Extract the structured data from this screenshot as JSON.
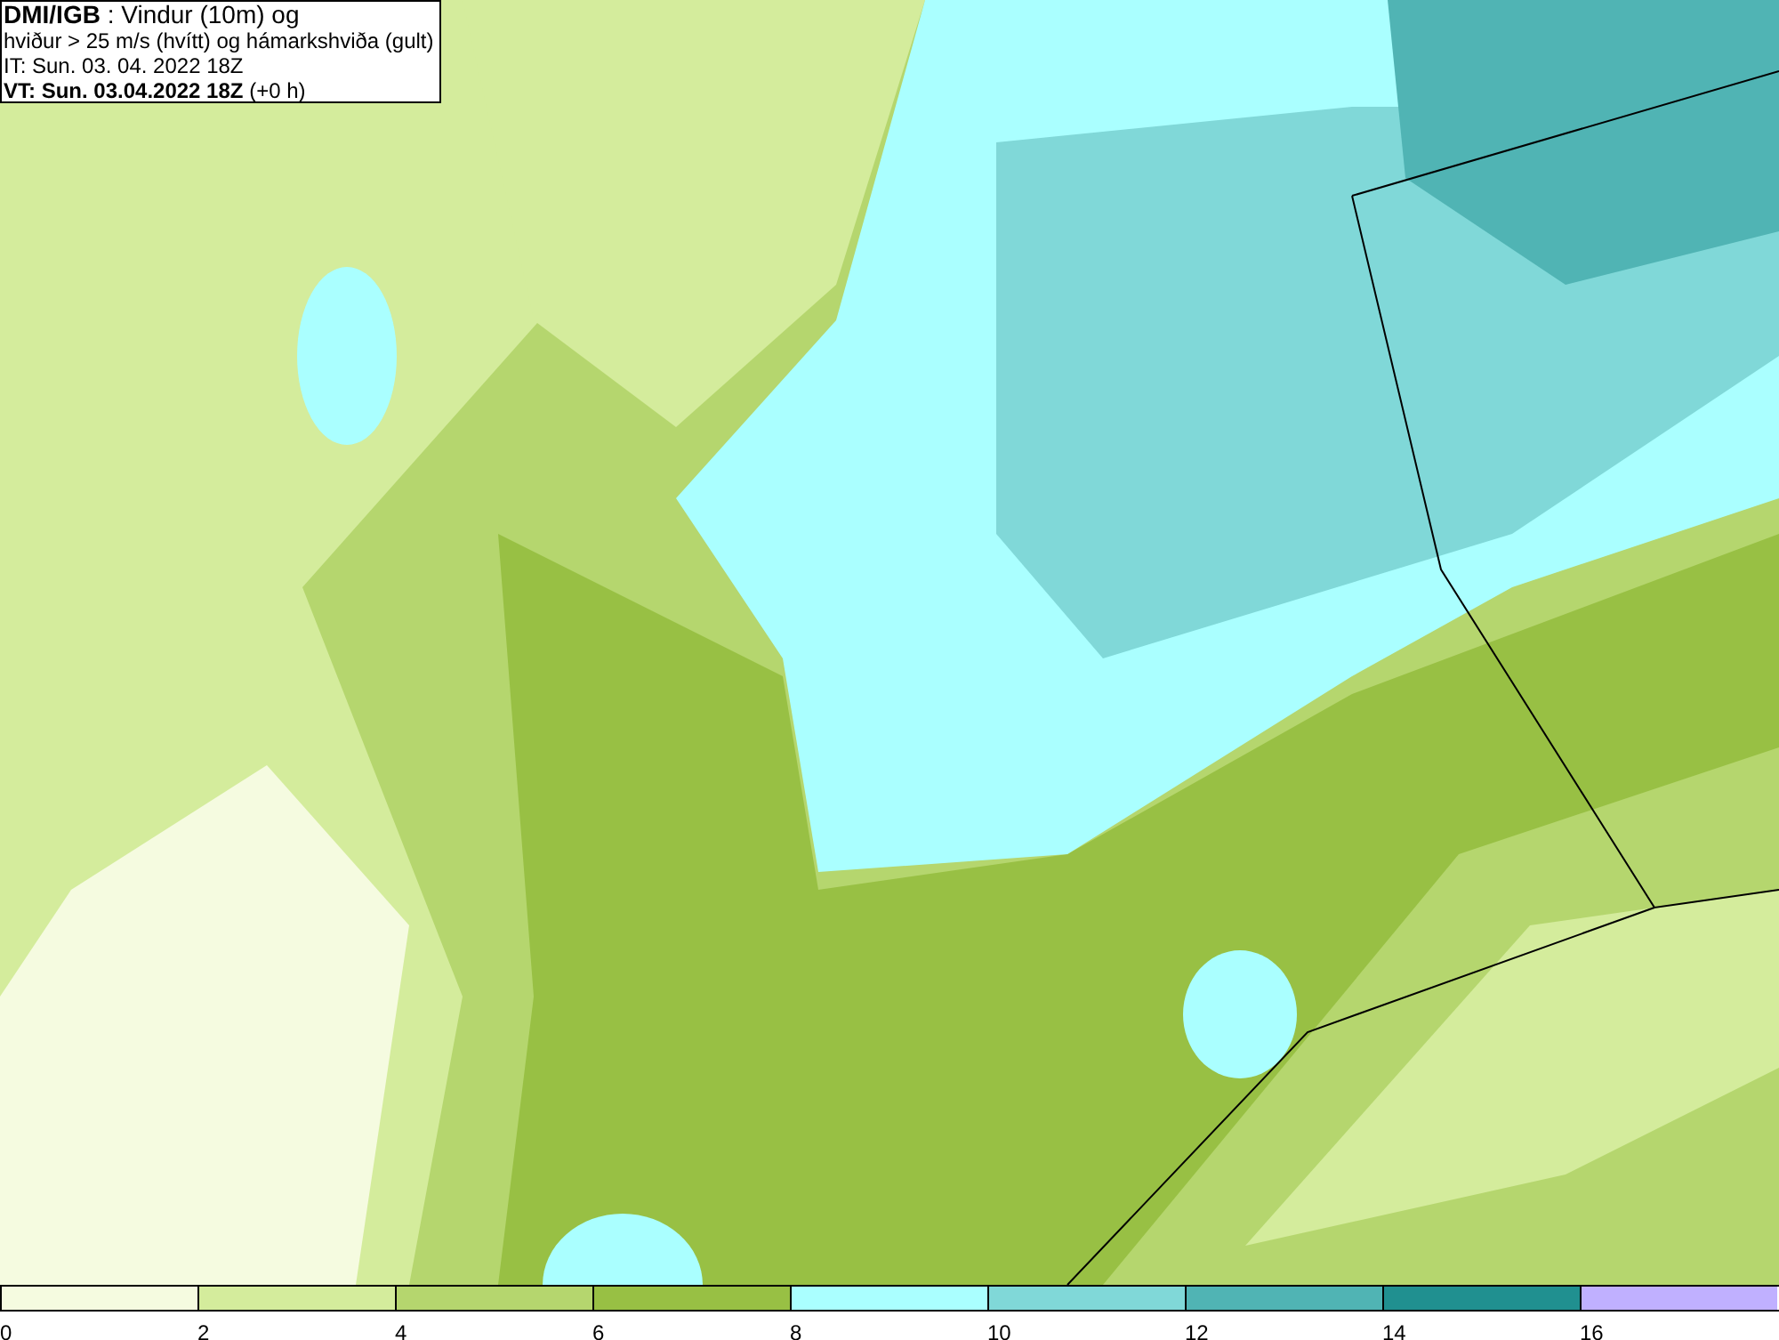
{
  "header": {
    "lines": [
      "**DMI/IGB** : Vindur (10m) og",
      "hviður > 25 m/s (hvítt) og hámarkshviða (gult)",
      "IT: Sun. 03. 04. 2022 18Z",
      "**VT: Sun. 03.04.2022 18Z** (+0 h)"
    ]
  },
  "legend": [
    {
      "label": "0",
      "color": "#f5fbe0"
    },
    {
      "label": "2",
      "color": "#d4ec9c"
    },
    {
      "label": "4",
      "color": "#b5d66e"
    },
    {
      "label": "6",
      "color": "#98c044"
    },
    {
      "label": "8",
      "color": "#aaffff"
    },
    {
      "label": "10",
      "color": "#80d8d8"
    },
    {
      "label": "12",
      "color": "#50b4b4"
    },
    {
      "label": "14",
      "color": "#209090"
    },
    {
      "label": "16",
      "color": "#c0b0ff"
    }
  ]
}
